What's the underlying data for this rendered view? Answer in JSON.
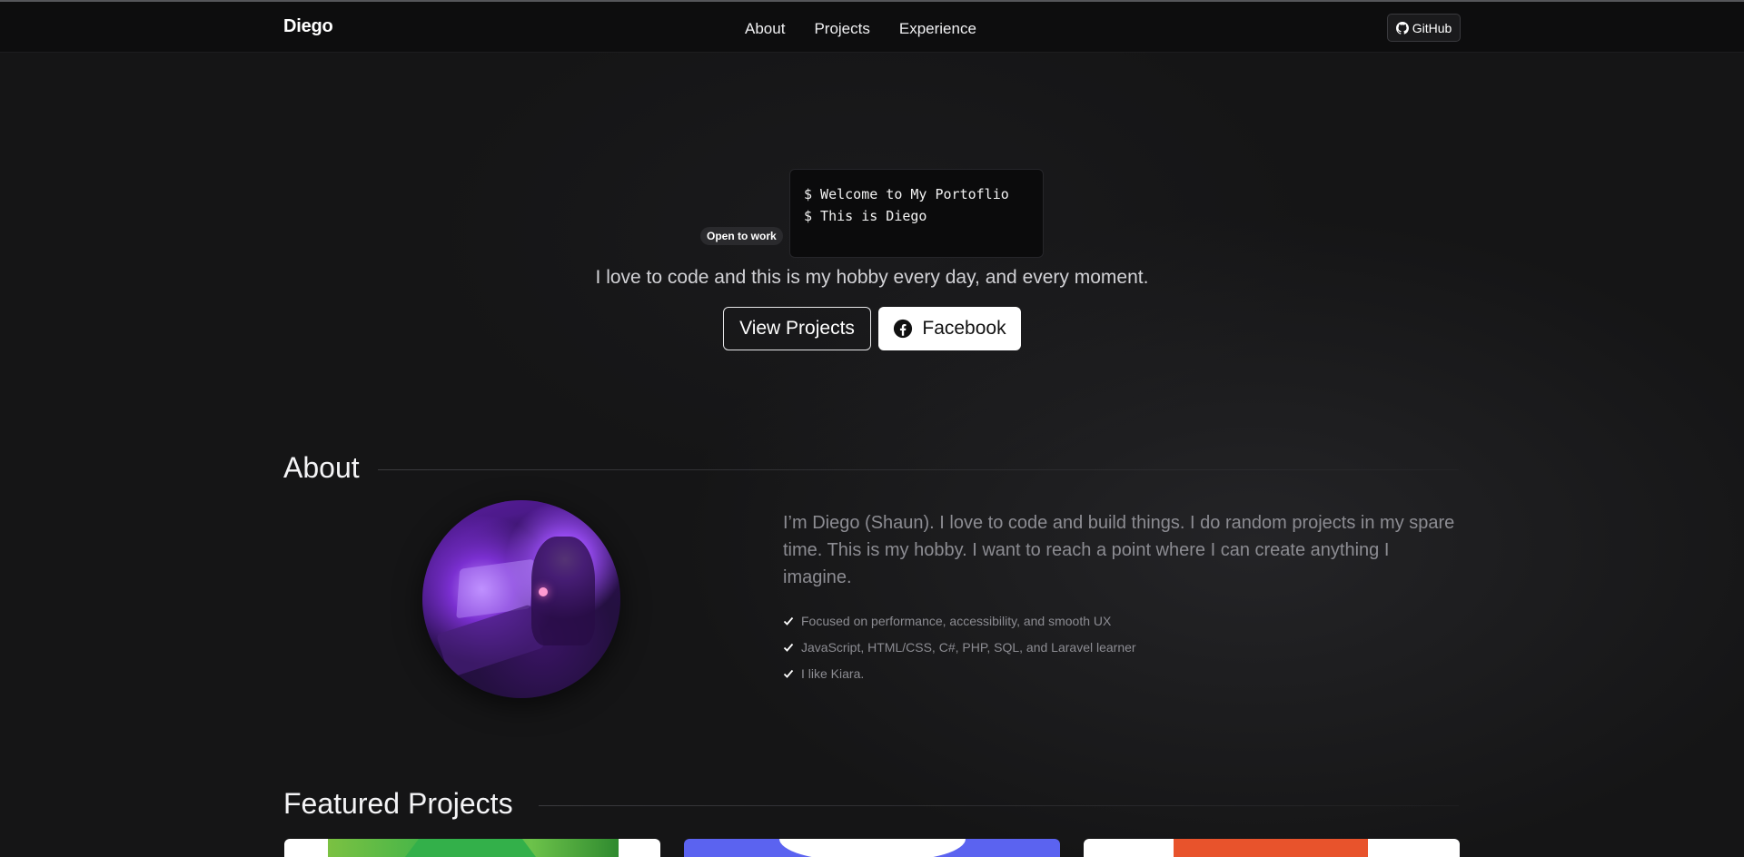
{
  "navbar": {
    "brand": "Diego",
    "links": [
      "About",
      "Projects",
      "Experience"
    ],
    "github_label": "GitHub"
  },
  "hero": {
    "badge": "Open to work",
    "terminal_lines": [
      "$ Welcome to My Portoflio",
      "$ This is Diego"
    ],
    "tagline": "I love to code and this is my hobby every day, and every moment.",
    "primary_button": "View Projects",
    "secondary_button": "Facebook"
  },
  "about": {
    "title": "About",
    "bio": "I’m Diego (Shaun). I love to code and build things. I do random projects in my spare time. This is my hobby. I want to reach a point where I can create anything I imagine.",
    "points": [
      "Focused on performance, accessibility, and smooth UX",
      "JavaScript, HTML/CSS, C#, PHP, SQL, and Laravel learner",
      "I like Kiara."
    ]
  },
  "projects": {
    "title": "Featured Projects"
  },
  "colors": {
    "background": "#151516",
    "navbar": "#0d0d0e",
    "text_muted": "#8c8c92"
  }
}
